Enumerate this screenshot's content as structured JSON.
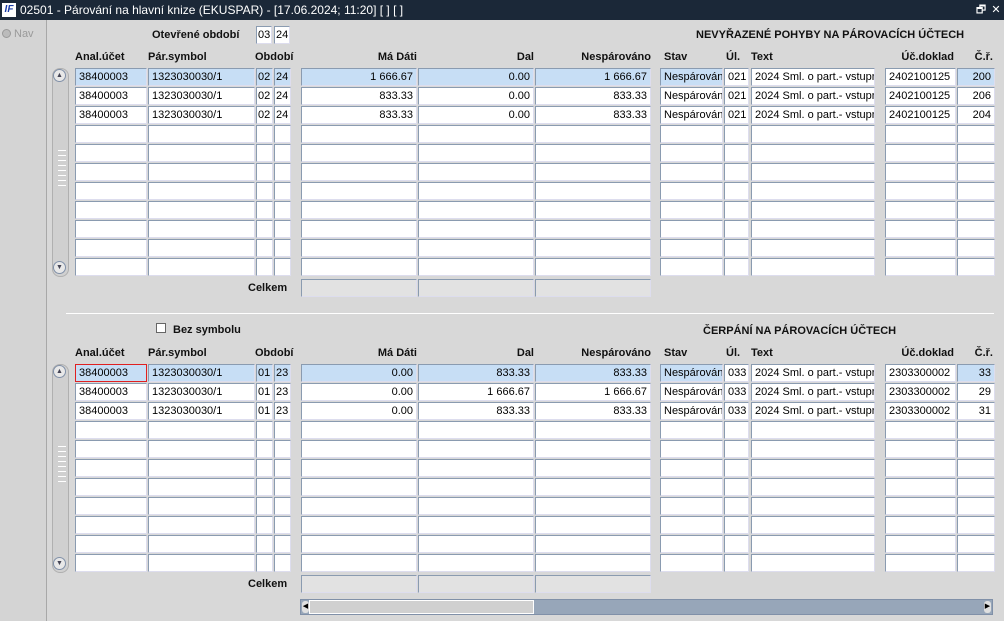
{
  "title": "02501 - Párování na hlavní knize (EKUSPAR) - [17.06.2024; 11:20]  [ ]  [ ]",
  "logo": "IF",
  "window_buttons": {
    "restore": "🗗",
    "close": "✕"
  },
  "nav": "Nav",
  "open_period": {
    "label": "Otevřené období",
    "month": "03",
    "year": "24"
  },
  "columns": {
    "anal": "Anal.účet",
    "symbol": "Pár.symbol",
    "period": "Období",
    "debit": "Má Dáti",
    "credit": "Dal",
    "unmatched": "Nespárováno",
    "status": "Stav",
    "ul": "Úl.",
    "text": "Text",
    "doc": "Úč.doklad",
    "row": "Č.ř."
  },
  "total_label": "Celkem",
  "top": {
    "heading": "NEVYŘAZENÉ POHYBY NA PÁROVACÍCH ÚČTECH",
    "rows": [
      {
        "anal": "38400003",
        "symbol": "1323030030/1",
        "month": "02",
        "year": "24",
        "debit": "1 666.67",
        "credit": "0.00",
        "unmatched": "1 666.67",
        "status": "Nespárován",
        "ul": "021",
        "text": "2024 Sml. o part.- vstupn",
        "doc": "2402100125",
        "row": "200"
      },
      {
        "anal": "38400003",
        "symbol": "1323030030/1",
        "month": "02",
        "year": "24",
        "debit": "833.33",
        "credit": "0.00",
        "unmatched": "833.33",
        "status": "Nespárován",
        "ul": "021",
        "text": "2024 Sml. o part.- vstupn",
        "doc": "2402100125",
        "row": "206"
      },
      {
        "anal": "38400003",
        "symbol": "1323030030/1",
        "month": "02",
        "year": "24",
        "debit": "833.33",
        "credit": "0.00",
        "unmatched": "833.33",
        "status": "Nespárován",
        "ul": "021",
        "text": "2024 Sml. o part.- vstupn",
        "doc": "2402100125",
        "row": "204"
      }
    ]
  },
  "bottom": {
    "heading": "ČERPÁNÍ NA PÁROVACÍCH ÚČTECH",
    "no_symbol_label": "Bez symbolu",
    "rows": [
      {
        "anal": "38400003",
        "symbol": "1323030030/1",
        "month": "01",
        "year": "23",
        "debit": "0.00",
        "credit": "833.33",
        "unmatched": "833.33",
        "status": "Nespárován",
        "ul": "033",
        "text": "2024 Sml. o part.- vstupn",
        "doc": "2303300002",
        "row": "33"
      },
      {
        "anal": "38400003",
        "symbol": "1323030030/1",
        "month": "01",
        "year": "23",
        "debit": "0.00",
        "credit": "1 666.67",
        "unmatched": "1 666.67",
        "status": "Nespárován",
        "ul": "033",
        "text": "2024 Sml. o part.- vstupn",
        "doc": "2303300002",
        "row": "29"
      },
      {
        "anal": "38400003",
        "symbol": "1323030030/1",
        "month": "01",
        "year": "23",
        "debit": "0.00",
        "credit": "833.33",
        "unmatched": "833.33",
        "status": "Nespárován",
        "ul": "033",
        "text": "2024 Sml. o part.- vstupn",
        "doc": "2303300002",
        "row": "31"
      }
    ]
  }
}
